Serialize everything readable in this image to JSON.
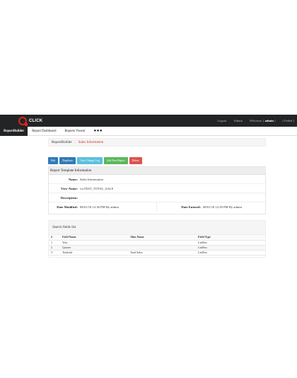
{
  "topbar": {
    "logo_text": "CLICK",
    "links": [
      {
        "text": "Logout"
      },
      {
        "text": "Admin"
      },
      {
        "prefix": "Welcome, ( ",
        "user": "admin",
        "suffix": " )"
      },
      {
        "text": "( Failed )"
      }
    ]
  },
  "nav": {
    "items": [
      {
        "label": "ReportBuilder",
        "active": true
      },
      {
        "label": "Report Dashboard"
      },
      {
        "label": "Reports Viewer"
      },
      {
        "label": "●●●"
      }
    ]
  },
  "breadcrumb": {
    "root": "ReportBuilder",
    "separator": "|",
    "current": "Sales Information"
  },
  "actions": {
    "edit": "Edit",
    "duplicate": "Duplicate",
    "view_change_log": "View Change Log",
    "add_new_report": "Add New Report",
    "delete": "Delete"
  },
  "template_info": {
    "heading": "Report Template Information",
    "name_label": "Name:",
    "name_value": "Sales Information",
    "view_name_label": "View Name:",
    "view_name_value": "vwTEST_TOTAL_SALE",
    "description_label": "Description:",
    "description_value": "",
    "date_modified_label": "Date Modified:",
    "date_modified_value": "08/01/18 12:30 PM By admin",
    "date_entered_label": "Date Entered:",
    "date_entered_value": "08/01/18 12:29 PM By admin"
  },
  "search_fields": {
    "heading": "Search fields list",
    "columns": [
      "#",
      "Field Name",
      "Alias Name",
      "Field Type"
    ],
    "rows": [
      [
        "1",
        "Year",
        "",
        "ListBox"
      ],
      [
        "2",
        "Quarter",
        "",
        "ListBox"
      ],
      [
        "3",
        "Totalsale",
        "Total Sales",
        "ListBox"
      ]
    ]
  },
  "colors": {
    "topbar_bg": "#222426",
    "brand_red": "#e2231a",
    "breadcrumb_current": "#c9302c",
    "btn_primary": "#337ab7",
    "btn_info": "#5bc0de",
    "btn_success": "#5cb85c",
    "btn_danger": "#d9534f"
  }
}
